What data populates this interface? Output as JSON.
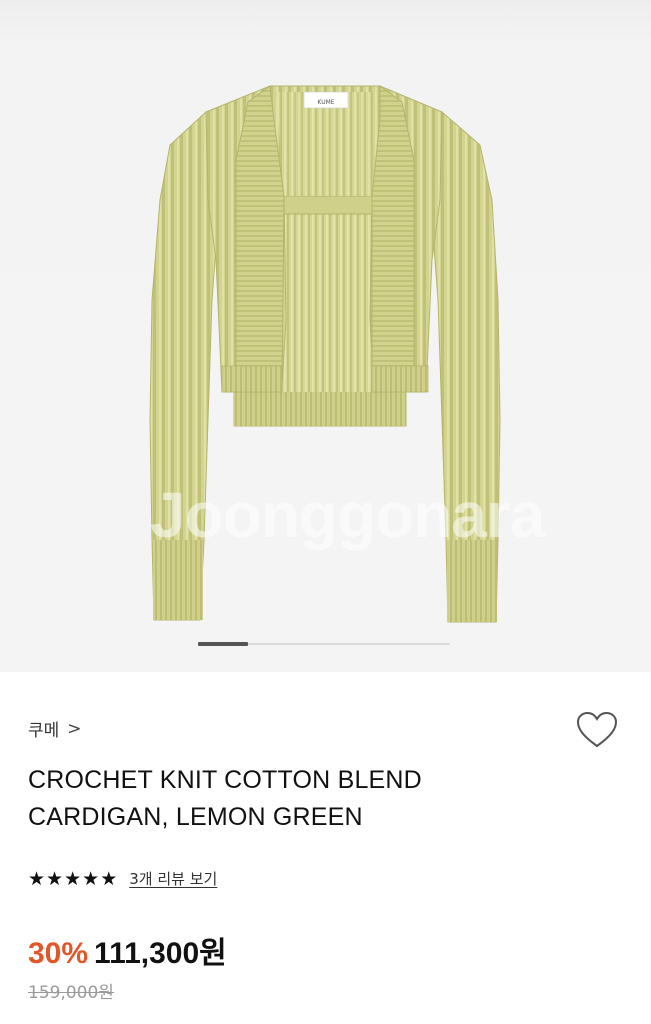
{
  "product_image": {
    "alt": "",
    "watermark": "Joonggonara",
    "label_text": "KUME",
    "colors": {
      "knit": "#d4d591",
      "knit_shadow": "#b6b86f",
      "knit_light": "#e2e3a8"
    },
    "carousel": {
      "total": 5,
      "active_index": 0
    }
  },
  "brand": {
    "name": "쿠메",
    "chevron": ">"
  },
  "wishlist": {
    "icon": "heart-outline-icon"
  },
  "title": {
    "line1": "CROCHET KNIT COTTON BLEND",
    "line2": "CARDIGAN, LEMON GREEN"
  },
  "rating": {
    "stars": 5,
    "star_glyph": "★",
    "review_link": "3개 리뷰 보기"
  },
  "price": {
    "discount": "30%",
    "sale": "111,300원",
    "original": "159,000원",
    "discount_color": "#e2572a"
  }
}
